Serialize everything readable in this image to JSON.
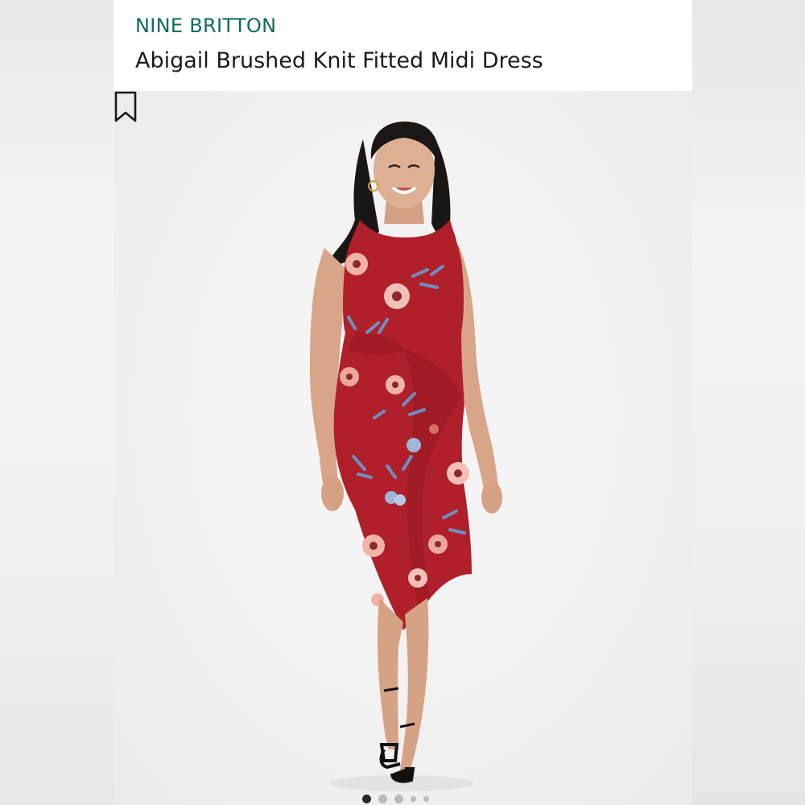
{
  "product": {
    "brand": "NINE BRITTON",
    "title": "Abigail Brushed Knit Fitted Midi Dress"
  },
  "colors": {
    "brand_text": "#0f6b5e",
    "title_text": "#1b1b1b",
    "dress_red": "#b0202a",
    "background": "#f2f2f2"
  },
  "icons": {
    "save": "bookmark-icon"
  },
  "gallery": {
    "image_count": 5,
    "current_index": 1
  }
}
